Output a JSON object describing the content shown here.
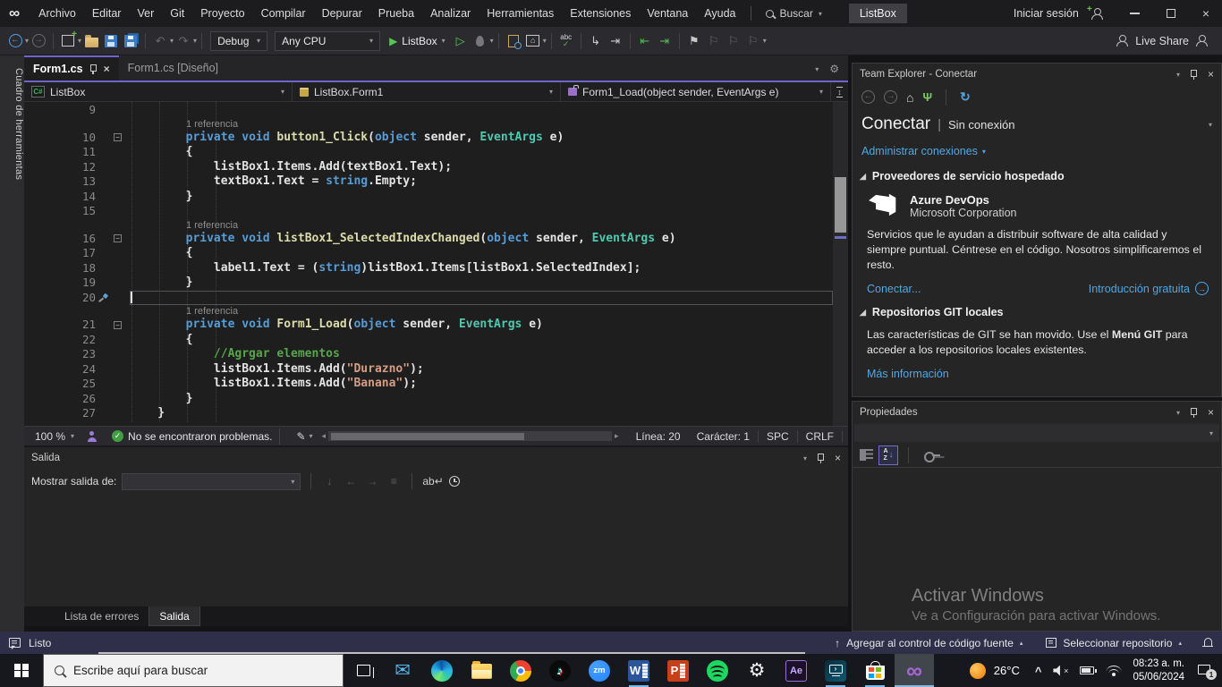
{
  "icons": {
    "vs_logo": "∞",
    "dropdown": "▾",
    "undo": "↶",
    "redo": "↷",
    "play": "▶",
    "play_outline": "▷",
    "home": "⌂",
    "check": "✓",
    "flag": "⚑",
    "flag_outline": "⚐",
    "pen": "✎",
    "plug": "Ψ",
    "refresh": "↻",
    "gear": "⚙",
    "envelope": "✉",
    "note": "♪",
    "zoom_label": "zm",
    "word_label": "W",
    "ppt_label": "P",
    "ae_label": "Ae",
    "infinity": "∞",
    "up_arrow": "↑",
    "back_arrow": "←",
    "fwd_arrow": "→",
    "left_small": "◂",
    "right_small": "▸",
    "tri_up": "▴",
    "wrap": "ab↵",
    "clear": "≡",
    "goto": "↓",
    "split": "↕",
    "section_tri": "◢",
    "intro_arrow": "→",
    "monitor_chevron": "›"
  },
  "title_bar": {
    "menus": [
      "Archivo",
      "Editar",
      "Ver",
      "Git",
      "Proyecto",
      "Compilar",
      "Depurar",
      "Prueba",
      "Analizar",
      "Herramientas",
      "Extensiones",
      "Ventana",
      "Ayuda"
    ],
    "search_label": "Buscar",
    "solution_badge": "ListBox",
    "sign_in": "Iniciar sesión"
  },
  "toolbar": {
    "config": "Debug",
    "platform": "Any CPU",
    "run_target": "ListBox",
    "live_share": "Live Share",
    "abc": "abc"
  },
  "toolbox_strip_label": "Cuadro de herramientas",
  "editor": {
    "tabs": [
      {
        "label": "Form1.cs"
      },
      {
        "label": "Form1.cs [Diseño]"
      }
    ],
    "nav": {
      "project_icon_label": "C#",
      "project": "ListBox",
      "type": "ListBox.Form1",
      "member": "Form1_Load(object sender, EventArgs e)"
    },
    "code": {
      "lines": [
        {
          "num": "9",
          "tok": []
        },
        {
          "lens": "1 referencia"
        },
        {
          "num": "10",
          "fold": true,
          "tok": [
            [
              "p",
              "        "
            ],
            [
              "k",
              "private"
            ],
            [
              "p",
              " "
            ],
            [
              "k",
              "void"
            ],
            [
              "p",
              " "
            ],
            [
              "m",
              "button1_Click"
            ],
            [
              "p",
              "("
            ],
            [
              "k",
              "object"
            ],
            [
              "p",
              " sender, "
            ],
            [
              "t",
              "EventArgs"
            ],
            [
              "p",
              " e)"
            ]
          ]
        },
        {
          "num": "11",
          "tok": [
            [
              "p",
              "        {"
            ]
          ]
        },
        {
          "num": "12",
          "tok": [
            [
              "p",
              "            listBox1.Items.Add(textBox1.Text);"
            ]
          ]
        },
        {
          "num": "13",
          "tok": [
            [
              "p",
              "            textBox1.Text = "
            ],
            [
              "k",
              "string"
            ],
            [
              "p",
              ".Empty;"
            ]
          ]
        },
        {
          "num": "14",
          "tok": [
            [
              "p",
              "        }"
            ]
          ]
        },
        {
          "num": "15",
          "tok": []
        },
        {
          "lens": "1 referencia"
        },
        {
          "num": "16",
          "fold": true,
          "tok": [
            [
              "p",
              "        "
            ],
            [
              "k",
              "private"
            ],
            [
              "p",
              " "
            ],
            [
              "k",
              "void"
            ],
            [
              "p",
              " "
            ],
            [
              "m",
              "listBox1_SelectedIndexChanged"
            ],
            [
              "p",
              "("
            ],
            [
              "k",
              "object"
            ],
            [
              "p",
              " sender, "
            ],
            [
              "t",
              "EventArgs"
            ],
            [
              "p",
              " e)"
            ]
          ]
        },
        {
          "num": "17",
          "tok": [
            [
              "p",
              "        {"
            ]
          ]
        },
        {
          "num": "18",
          "tok": [
            [
              "p",
              "            label1.Text = ("
            ],
            [
              "k",
              "string"
            ],
            [
              "p",
              ")listBox1.Items[listBox1.SelectedIndex];"
            ]
          ]
        },
        {
          "num": "19",
          "tok": [
            [
              "p",
              "        }"
            ]
          ]
        },
        {
          "num": "20",
          "cursor": true,
          "tok": []
        },
        {
          "lens": "1 referencia"
        },
        {
          "num": "21",
          "fold": true,
          "tok": [
            [
              "p",
              "        "
            ],
            [
              "k",
              "private"
            ],
            [
              "p",
              " "
            ],
            [
              "k",
              "void"
            ],
            [
              "p",
              " "
            ],
            [
              "m",
              "Form1_Load"
            ],
            [
              "p",
              "("
            ],
            [
              "k",
              "object"
            ],
            [
              "p",
              " sender, "
            ],
            [
              "t",
              "EventArgs"
            ],
            [
              "p",
              " e)"
            ]
          ]
        },
        {
          "num": "22",
          "tok": [
            [
              "p",
              "        {"
            ]
          ]
        },
        {
          "num": "23",
          "tok": [
            [
              "c",
              "            //Agrgar elementos"
            ]
          ]
        },
        {
          "num": "24",
          "tok": [
            [
              "p",
              "            listBox1.Items.Add("
            ],
            [
              "s",
              "\"Durazno\""
            ],
            [
              "p",
              ");"
            ]
          ]
        },
        {
          "num": "25",
          "tok": [
            [
              "p",
              "            listBox1.Items.Add("
            ],
            [
              "s",
              "\"Banana\""
            ],
            [
              "p",
              ");"
            ]
          ]
        },
        {
          "num": "26",
          "tok": [
            [
              "p",
              "        }"
            ]
          ]
        },
        {
          "num": "27",
          "tok": [
            [
              "p",
              "    }"
            ]
          ]
        }
      ]
    },
    "status": {
      "zoom": "100 %",
      "problems": "No se encontraron problemas.",
      "line": "Línea: 20",
      "column": "Carácter: 1",
      "spaces": "SPC",
      "eol": "CRLF"
    }
  },
  "output_panel": {
    "title": "Salida",
    "show_output_label": "Mostrar salida de:",
    "tabs": [
      {
        "label": "Lista de errores"
      },
      {
        "label": "Salida"
      }
    ]
  },
  "team_explorer": {
    "title": "Team Explorer - Conectar",
    "heading": "Conectar",
    "heading_separator": "|",
    "heading_status": "Sin conexión",
    "manage_connections": "Administrar conexiones",
    "hosted_providers": "Proveedores de servicio hospedado",
    "azure": {
      "name": "Azure DevOps",
      "company": "Microsoft Corporation",
      "description": "Servicios que le ayudan a distribuir software de alta calidad y siempre puntual. Céntrese en el código. Nosotros simplificaremos el resto.",
      "connect": "Conectar...",
      "intro": "Introducción gratuita"
    },
    "git_repos": "Repositorios GIT locales",
    "git_text_1": "Las características de GIT se han movido. Use el ",
    "git_text_bold": "Menú GIT",
    "git_text_2": " para acceder a los repositorios locales existentes.",
    "more_info": "Más información"
  },
  "properties_panel": {
    "title": "Propiedades"
  },
  "watermark": {
    "line1": "Activar Windows",
    "line2": "Ve a Configuración para activar Windows."
  },
  "status_bar": {
    "ready": "Listo",
    "add_to_source_control": "Agregar al control de código fuente",
    "select_repository": "Seleccionar repositorio"
  },
  "taskbar": {
    "search_placeholder": "Escribe aquí para buscar",
    "tray": {
      "temperature": "26°C",
      "time": "08:23 a. m.",
      "date": "05/06/2024",
      "notification_count": "1"
    }
  },
  "colors": {
    "accent": "#6F63CE",
    "keyword": "#569CD6",
    "type": "#4EC9B0",
    "string": "#D69D85",
    "comment": "#57A64A",
    "link": "#51A7E0"
  }
}
